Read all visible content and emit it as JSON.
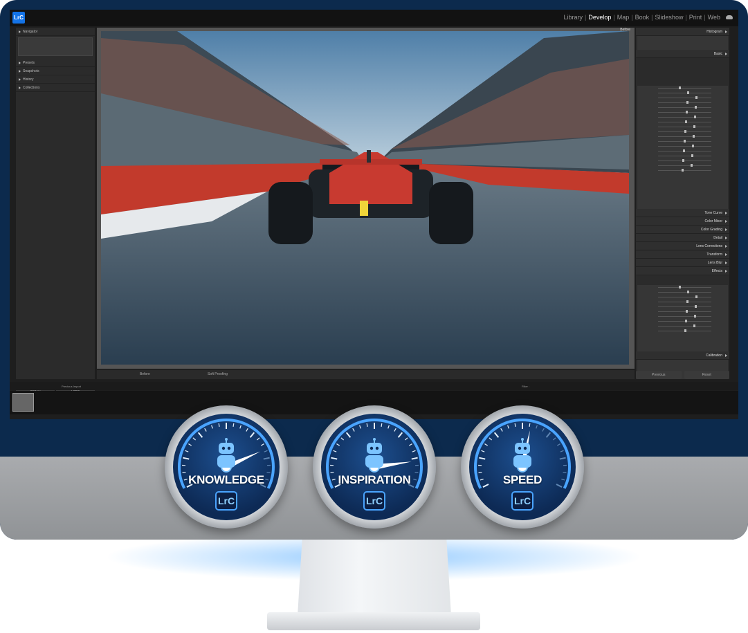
{
  "app": {
    "logo": "LrC",
    "modules": [
      "Library",
      "Develop",
      "Map",
      "Book",
      "Slideshow",
      "Print",
      "Web"
    ],
    "active_module": "Develop"
  },
  "left_panel": {
    "sections": [
      "Navigator",
      "Presets",
      "Snapshots",
      "History",
      "Collections"
    ],
    "copy_label": "Copy...",
    "paste_label": "Paste"
  },
  "image_view": {
    "before_label": "Before"
  },
  "toolbar": {
    "before_label": "Before",
    "soft_proofing_label": "Soft Proofing"
  },
  "right_panel": {
    "sections": [
      "Histogram",
      "Basic",
      "Tone Curve",
      "Color Mixer",
      "Color Grading",
      "Detail",
      "Lens Corrections",
      "Transform",
      "Lens Blur",
      "Effects",
      "Calibration"
    ],
    "previous_label": "Previous",
    "reset_label": "Reset"
  },
  "filmstrip": {
    "path_label": "Previous Import",
    "filter_label": "Filter :"
  },
  "gauges": [
    {
      "label": "KNOWLEDGE",
      "badge": "LrC",
      "level": 0.78
    },
    {
      "label": "INSPIRATION",
      "badge": "LrC",
      "level": 0.85
    },
    {
      "label": "SPEED",
      "badge": "LrC",
      "level": 0.55
    }
  ],
  "colors": {
    "monitor_bezel": "#0c2a4d",
    "lr_blue": "#1473e6",
    "gauge_face": "#1d4f8f",
    "gauge_accent": "#4aa4ff"
  }
}
